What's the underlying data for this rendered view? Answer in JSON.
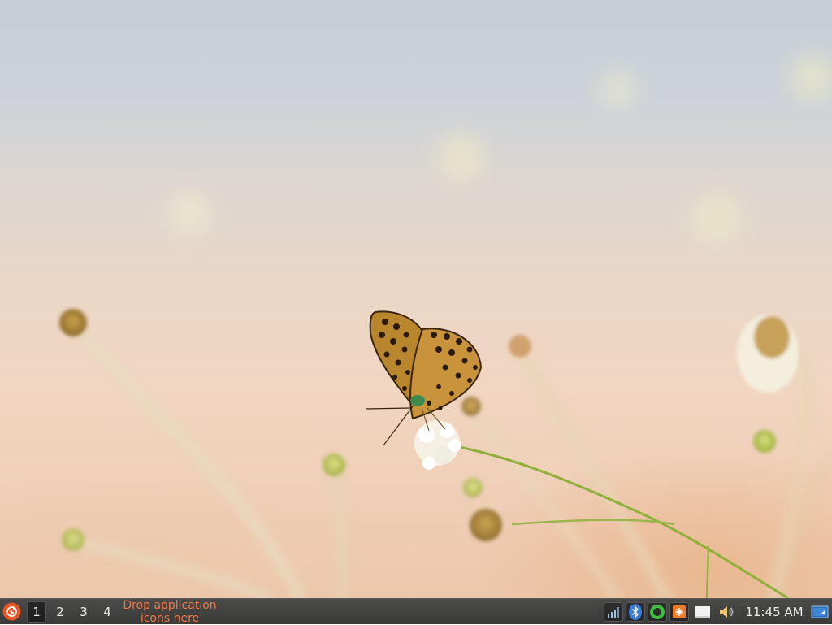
{
  "desktop": {
    "wallpaper": "butterfly-on-flower-photo"
  },
  "panel": {
    "menu_icon": "app-menu-icon",
    "workspaces": [
      {
        "label": "1",
        "active": true
      },
      {
        "label": "2",
        "active": false
      },
      {
        "label": "3",
        "active": false
      },
      {
        "label": "4",
        "active": false
      }
    ],
    "launcher_hint": "Drop application icons here",
    "tray_icons": [
      "network-signal-icon",
      "bluetooth-icon",
      "circle-status-icon",
      "updates-icon",
      "notes-icon",
      "volume-icon"
    ],
    "clock": "11:45 AM",
    "show_desktop_icon": "show-desktop-icon"
  },
  "colors": {
    "panel_bg": "#3d3d3b",
    "accent": "#f07746",
    "menu_orange": "#e95420",
    "bluetooth_blue": "#3b7dd8",
    "status_green": "#3fbf3f"
  }
}
